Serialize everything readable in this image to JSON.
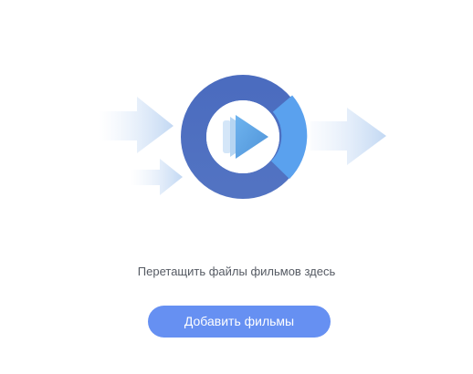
{
  "drop_zone": {
    "icon": "video-import-icon",
    "hint_text": "Перетащить файлы фильмов здесь",
    "add_button_label": "Добавить фильмы"
  },
  "colors": {
    "ring_dark": "#4a6fc0",
    "ring_light": "#5aa1ee",
    "play_icon": "#5ea5e4",
    "arrow_tint": "#c9def5",
    "button_bg": "#6690f2",
    "button_text": "#ffffff",
    "hint_text": "#555a63"
  }
}
